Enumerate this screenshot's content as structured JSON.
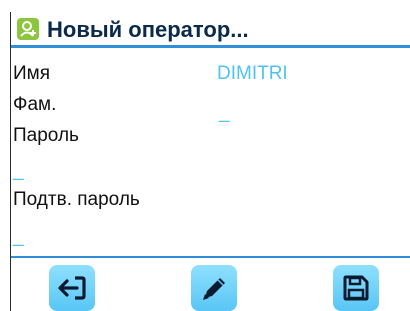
{
  "header": {
    "title": "Новый оператор...",
    "icon": "add-user-icon",
    "icon_color": "#8cc63f"
  },
  "form": {
    "name_label": "Имя",
    "name_value": "DIMITRI",
    "surname_label": "Фам.",
    "surname_value": "_",
    "password_label": "Пароль",
    "password_value": "_",
    "confirm_label": "Подтв. пароль",
    "confirm_value": "_"
  },
  "toolbar": {
    "buttons": [
      {
        "icon": "back-icon"
      },
      {
        "icon": "pencil-icon"
      },
      {
        "icon": "save-icon"
      }
    ]
  },
  "colors": {
    "accent": "#2f8fd8",
    "value_text": "#4fc3f2",
    "button_fill": "#58c6f4"
  }
}
